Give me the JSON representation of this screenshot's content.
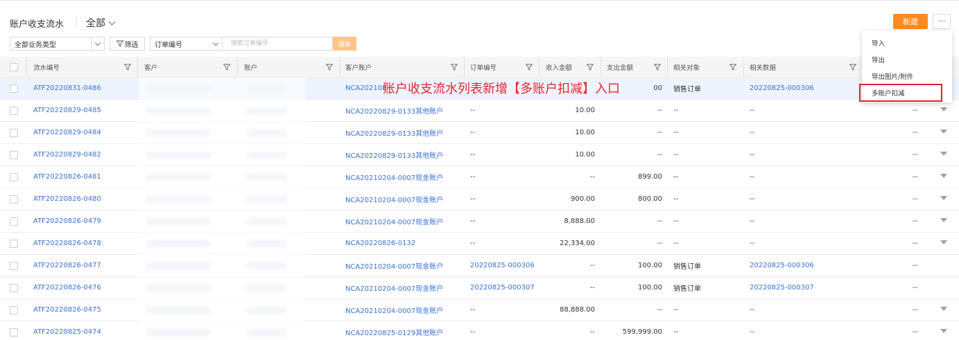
{
  "header": {
    "title": "账户收支流水",
    "scope": "全部",
    "new_button": "新建",
    "more_button": "···"
  },
  "filters": {
    "type_select": "全部业务类型",
    "filter_button": "筛选",
    "field_select": "订单编号",
    "search_placeholder": "搜索订单编号",
    "search_button": "搜索"
  },
  "columns": [
    "流水编号",
    "客户",
    "账户",
    "客户账户",
    "订单编号",
    "收入金额",
    "支出金额",
    "相关对象",
    "相关数据"
  ],
  "menu": {
    "items": [
      "导入",
      "导出",
      "导出图片/附件",
      "多账户扣减"
    ]
  },
  "annotation": "账户收支流水列表新增【多账户扣减】入口",
  "rows": [
    {
      "id": "ATF20220831-0486",
      "cust_account": "NCA202108",
      "order": "",
      "income": "",
      "expense": "00",
      "obj": "销售订单",
      "data": "20220825-000306",
      "caret": false
    },
    {
      "id": "ATF20220829-0485",
      "cust_account": "NCA20220829-0133其他账户",
      "order": "--",
      "income": "10.00",
      "expense": "--",
      "obj": "--",
      "data": "--",
      "caret": true
    },
    {
      "id": "ATF20220829-0484",
      "cust_account": "NCA20220829-0133其他账户",
      "order": "--",
      "income": "10.00",
      "expense": "--",
      "obj": "--",
      "data": "--",
      "caret": true
    },
    {
      "id": "ATF20220829-0482",
      "cust_account": "NCA20220829-0133其他账户",
      "order": "--",
      "income": "10.00",
      "expense": "--",
      "obj": "--",
      "data": "--",
      "caret": true
    },
    {
      "id": "ATF20220826-0481",
      "cust_account": "NCA20210204-0007现金账户",
      "order": "--",
      "income": "--",
      "expense": "899.00",
      "obj": "--",
      "data": "--",
      "caret": true
    },
    {
      "id": "ATF20220826-0480",
      "cust_account": "NCA20210204-0007现金账户",
      "order": "--",
      "income": "900.00",
      "expense": "800.00",
      "obj": "--",
      "data": "--",
      "caret": true
    },
    {
      "id": "ATF20220826-0479",
      "cust_account": "NCA20210204-0007现金账户",
      "order": "--",
      "income": "8,888.00",
      "expense": "--",
      "obj": "--",
      "data": "--",
      "caret": true
    },
    {
      "id": "ATF20220826-0478",
      "cust_account": "NCA20220826-0132",
      "order": "--",
      "income": "22,334.00",
      "expense": "--",
      "obj": "--",
      "data": "--",
      "caret": true
    },
    {
      "id": "ATF20220826-0477",
      "cust_account": "NCA20210204-0007现金账户",
      "order": "20220825-000306",
      "income": "--",
      "expense": "100.00",
      "obj": "销售订单",
      "data": "20220825-000306",
      "caret": false
    },
    {
      "id": "ATF20220826-0476",
      "cust_account": "NCA20210204-0007现金账户",
      "order": "20220825-000307",
      "income": "--",
      "expense": "100.00",
      "obj": "销售订单",
      "data": "20220825-000307",
      "caret": false
    },
    {
      "id": "ATF20220826-0475",
      "cust_account": "NCA20210204-0007现金账户",
      "order": "--",
      "income": "88,888.00",
      "expense": "--",
      "obj": "--",
      "data": "--",
      "caret": true
    },
    {
      "id": "ATF20220825-0474",
      "cust_account": "NCA20220825-0129其他账户",
      "order": "--",
      "income": "--",
      "expense": "599,999.00",
      "obj": "--",
      "data": "--",
      "caret": true
    }
  ]
}
